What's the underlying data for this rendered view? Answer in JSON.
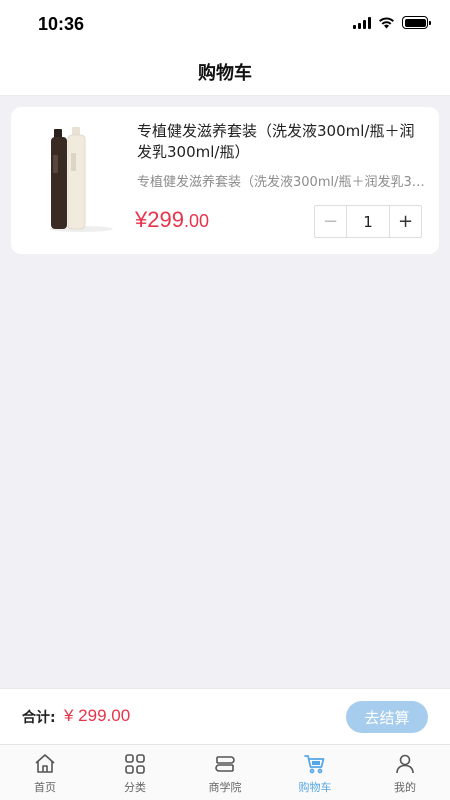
{
  "status_bar": {
    "time": "10:36"
  },
  "nav": {
    "title": "购物车"
  },
  "cart": {
    "items": [
      {
        "title": "专植健发滋养套装（洗发液300ml/瓶＋润发乳300ml/瓶）",
        "subtitle": "专植健发滋养套装（洗发液300ml/瓶＋润发乳300ml/瓶）",
        "price_currency": "¥",
        "price_int": "299",
        "price_dec": ".00",
        "quantity": "1",
        "minus_label": "−",
        "plus_label": "+"
      }
    ]
  },
  "checkout": {
    "total_label": "合计:",
    "total_value": "¥ 299.00",
    "button_label": "去结算"
  },
  "tabs": [
    {
      "label": "首页",
      "icon": "home-icon",
      "active": false
    },
    {
      "label": "分类",
      "icon": "grid-icon",
      "active": false
    },
    {
      "label": "商学院",
      "icon": "book-icon",
      "active": false
    },
    {
      "label": "购物车",
      "icon": "cart-icon",
      "active": true
    },
    {
      "label": "我的",
      "icon": "user-icon",
      "active": false
    }
  ],
  "colors": {
    "price": "#e8344b",
    "accent": "#55a6e6",
    "checkout_button": "#a7cdee",
    "background": "#f1f1f5"
  }
}
